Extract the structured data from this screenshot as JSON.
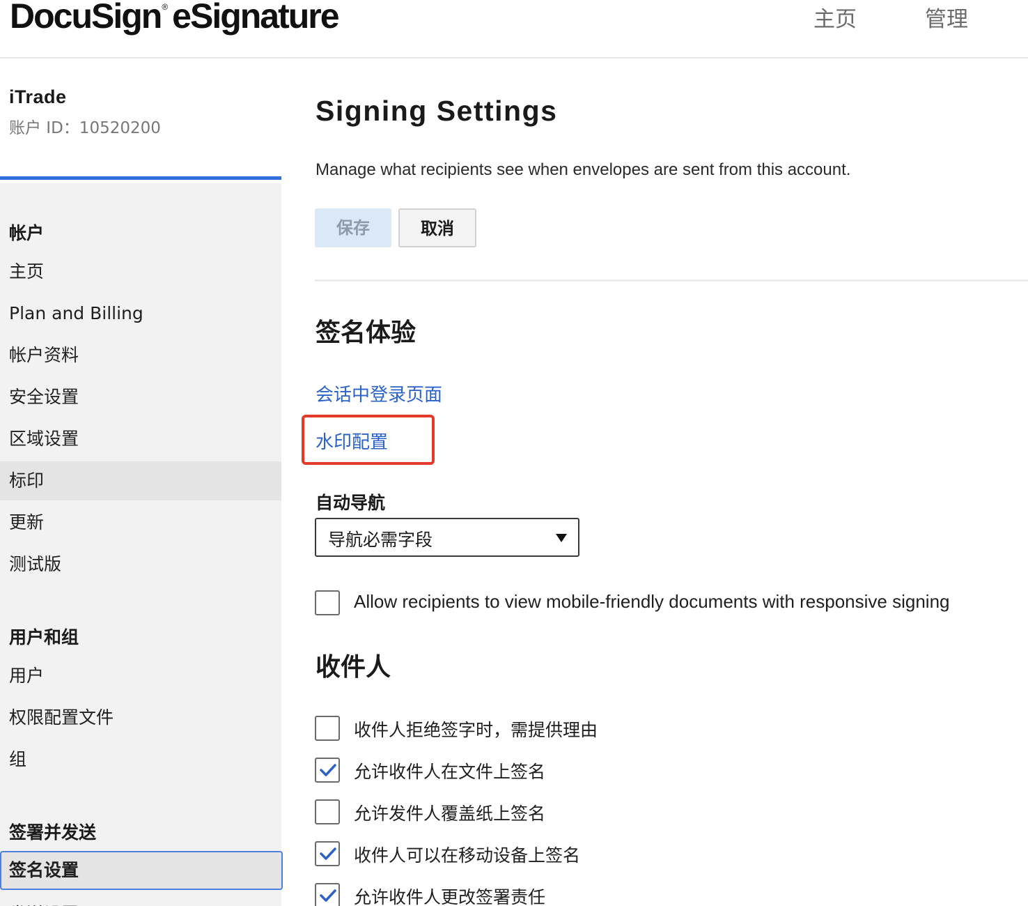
{
  "header": {
    "logo_text": "DocuSign",
    "logo_reg": "®",
    "logo_product": "eSignature",
    "nav_home": "主页",
    "nav_admin": "管理"
  },
  "account": {
    "name": "iTrade",
    "id_label": "账户 ID：10520200"
  },
  "sidebar": {
    "sections": [
      {
        "heading": "帐户",
        "items": [
          "主页",
          "Plan and Billing",
          "帐户资料",
          "安全设置",
          "区域设置",
          "标印",
          "更新",
          "测试版"
        ]
      },
      {
        "heading": "用户和组",
        "items": [
          "用户",
          "权限配置文件",
          "组"
        ]
      },
      {
        "heading": "签署并发送",
        "items": [
          "签名设置",
          "发送设置"
        ]
      }
    ],
    "hover_item": "标印",
    "active_item": "签名设置"
  },
  "main": {
    "title": "Signing Settings",
    "description": "Manage what recipients see when envelopes are sent from this account.",
    "save_label": "保存",
    "cancel_label": "取消",
    "section_experience": "签名体验",
    "link_inperson": "会话中登录页面",
    "link_watermark": "水印配置",
    "auto_nav_label": "自动导航",
    "auto_nav_value": "导航必需字段",
    "responsive_label": "Allow recipients to view mobile-friendly documents with responsive signing",
    "responsive_checked": false,
    "section_recipients": "收件人",
    "recipient_options": [
      {
        "label": "收件人拒绝签字时，需提供理由",
        "checked": false
      },
      {
        "label": "允许收件人在文件上签名",
        "checked": true
      },
      {
        "label": "允许发件人覆盖纸上签名",
        "checked": false
      },
      {
        "label": "收件人可以在移动设备上签名",
        "checked": true
      },
      {
        "label": "允许收件人更改签署责任",
        "checked": true
      }
    ]
  },
  "colors": {
    "accent_blue": "#2f6fdf",
    "link_blue": "#2a62c9",
    "highlight_red": "#e33a2a",
    "save_disabled_bg": "#dbe8f6"
  }
}
